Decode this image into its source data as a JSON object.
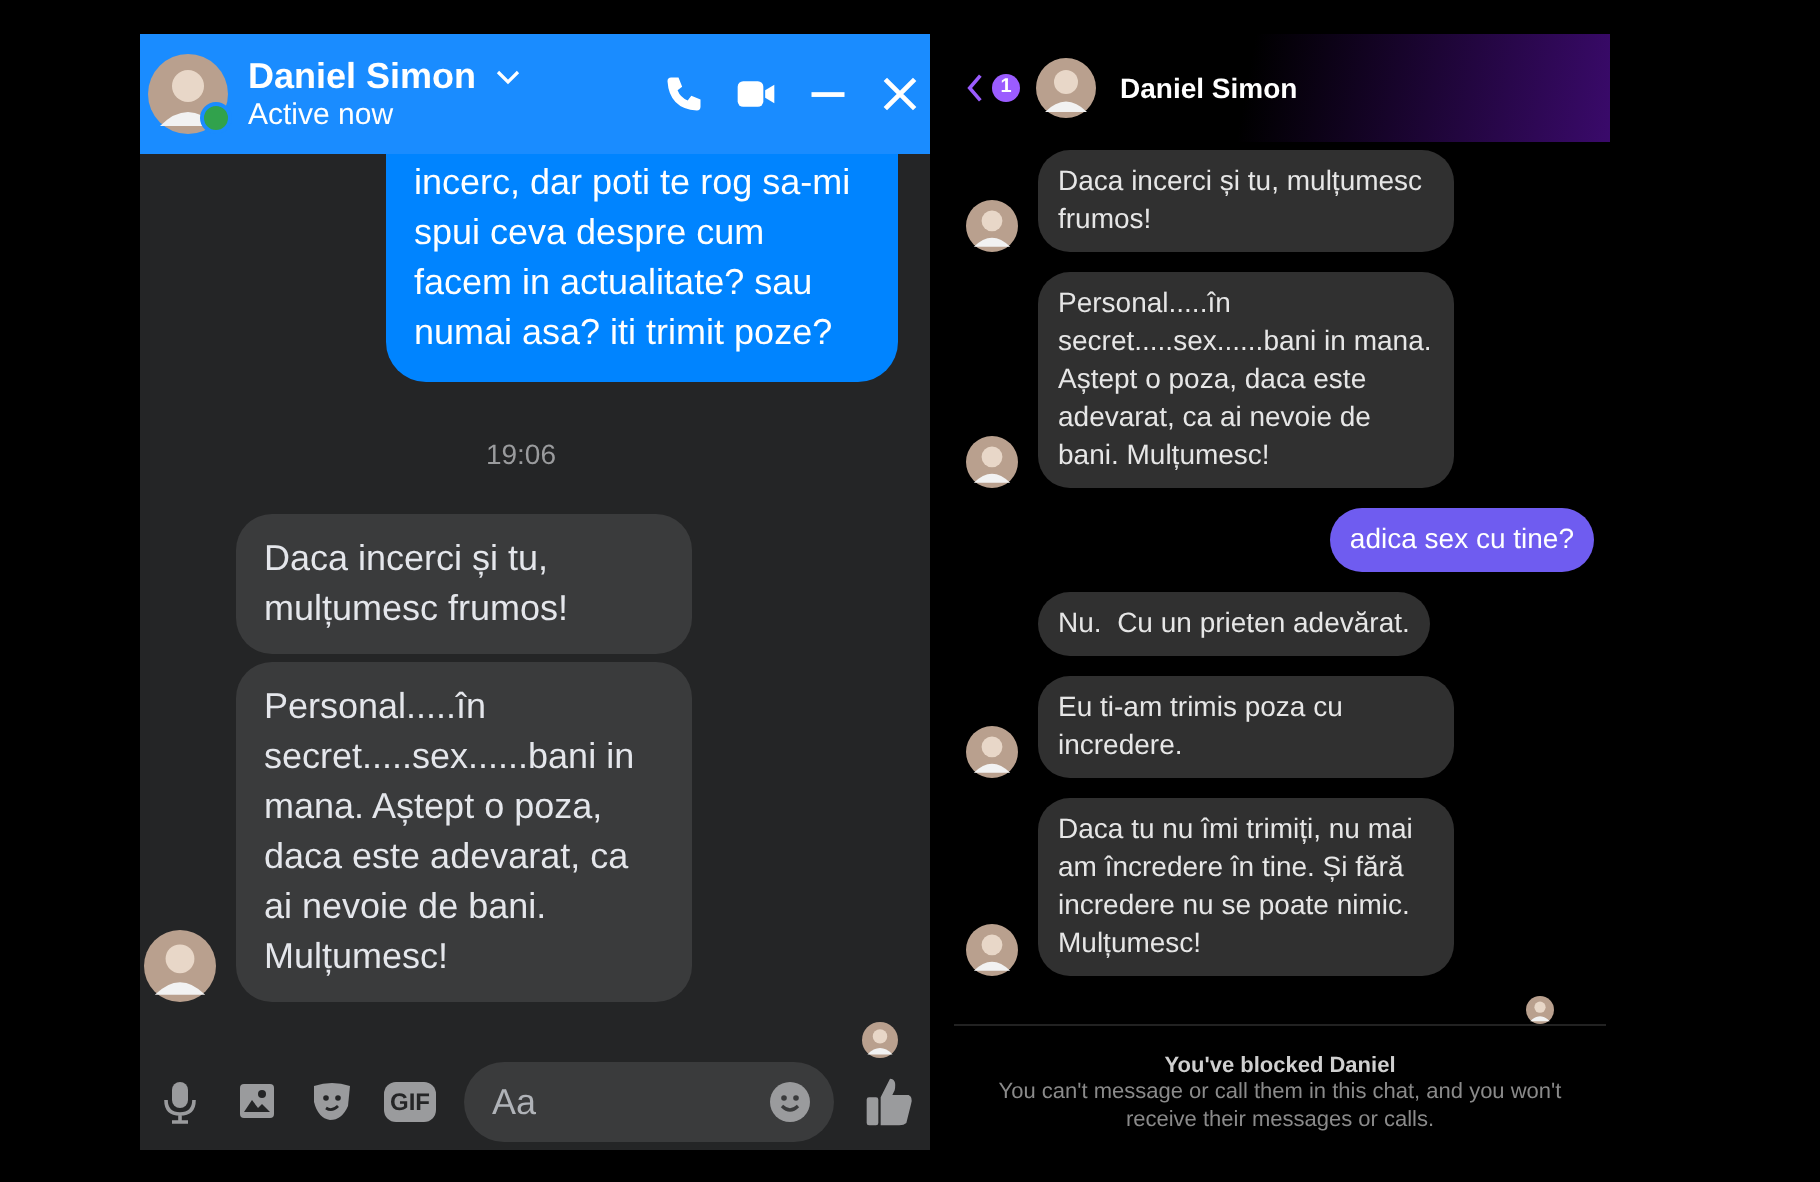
{
  "left_chat": {
    "header": {
      "name": "Daniel Simon",
      "status": "Active now",
      "online": true
    },
    "messages": [
      {
        "kind": "outgoing",
        "text": "incerc, dar poti te rog sa-mi spui ceva despre cum facem in actualitate? sau numai asa? iti trimit poze?"
      },
      {
        "kind": "time",
        "text": "19:06"
      },
      {
        "kind": "incoming",
        "text": "Daca incerci și tu, mulțumesc frumos!",
        "avatar": false
      },
      {
        "kind": "incoming",
        "text": "Personal.....în secret.....sex......bani in mana. Aștept o poza, daca este adevarat, ca ai nevoie de bani. Mulțumesc!",
        "avatar": true
      },
      {
        "kind": "seen"
      }
    ],
    "composer": {
      "gif_label": "GIF",
      "placeholder": "Aa"
    }
  },
  "right_chat": {
    "header": {
      "unread_badge": "1",
      "name": "Daniel Simon"
    },
    "messages": [
      {
        "kind": "incoming",
        "text": "Daca incerci și tu, mulțumesc frumos!",
        "avatar": true
      },
      {
        "kind": "incoming",
        "text": "Personal.....în secret.....sex......bani in mana. Aștept o poza, daca este adevarat, ca ai nevoie de bani. Mulțumesc!",
        "avatar": true
      },
      {
        "kind": "outgoing",
        "text": "adica sex cu tine?"
      },
      {
        "kind": "incoming",
        "text": "Nu.  Cu un prieten adevărat.",
        "avatar": false
      },
      {
        "kind": "incoming",
        "text": "Eu ti-am trimis poza cu incredere.",
        "avatar": true
      },
      {
        "kind": "incoming",
        "text": "Daca tu nu îmi trimiți, nu mai am încredere în tine. Și fără incredere nu se poate nimic. Mulțumesc!",
        "avatar": true
      },
      {
        "kind": "seen"
      }
    ],
    "blocked_notice": {
      "title": "You've blocked Daniel",
      "text": "You can't message or call them in this chat, and you won't receive their messages or calls."
    }
  }
}
